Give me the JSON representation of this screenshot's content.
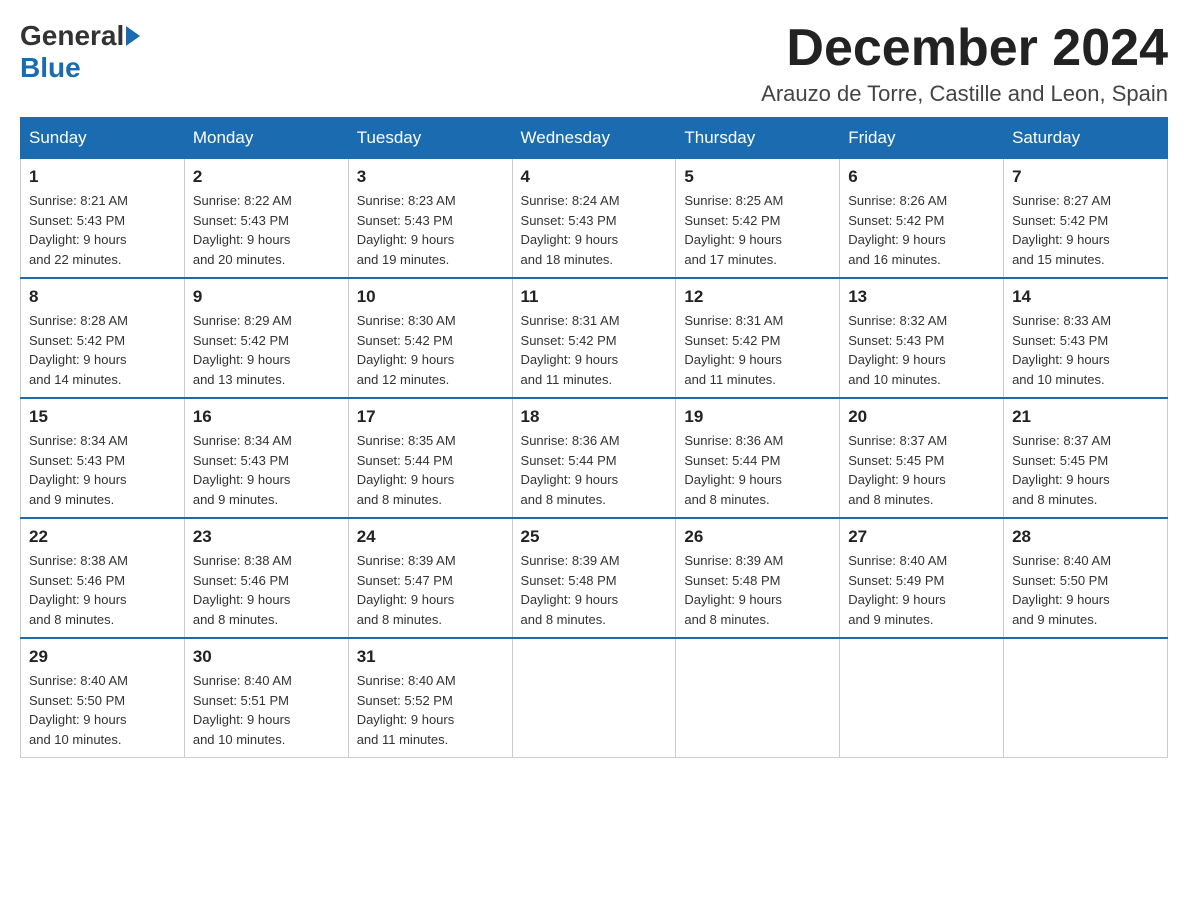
{
  "header": {
    "logo_general": "General",
    "logo_blue": "Blue",
    "month_title": "December 2024",
    "location": "Arauzo de Torre, Castille and Leon, Spain"
  },
  "weekdays": [
    "Sunday",
    "Monday",
    "Tuesday",
    "Wednesday",
    "Thursday",
    "Friday",
    "Saturday"
  ],
  "weeks": [
    [
      {
        "day": "1",
        "sunrise": "8:21 AM",
        "sunset": "5:43 PM",
        "daylight": "9 hours and 22 minutes."
      },
      {
        "day": "2",
        "sunrise": "8:22 AM",
        "sunset": "5:43 PM",
        "daylight": "9 hours and 20 minutes."
      },
      {
        "day": "3",
        "sunrise": "8:23 AM",
        "sunset": "5:43 PM",
        "daylight": "9 hours and 19 minutes."
      },
      {
        "day": "4",
        "sunrise": "8:24 AM",
        "sunset": "5:43 PM",
        "daylight": "9 hours and 18 minutes."
      },
      {
        "day": "5",
        "sunrise": "8:25 AM",
        "sunset": "5:42 PM",
        "daylight": "9 hours and 17 minutes."
      },
      {
        "day": "6",
        "sunrise": "8:26 AM",
        "sunset": "5:42 PM",
        "daylight": "9 hours and 16 minutes."
      },
      {
        "day": "7",
        "sunrise": "8:27 AM",
        "sunset": "5:42 PM",
        "daylight": "9 hours and 15 minutes."
      }
    ],
    [
      {
        "day": "8",
        "sunrise": "8:28 AM",
        "sunset": "5:42 PM",
        "daylight": "9 hours and 14 minutes."
      },
      {
        "day": "9",
        "sunrise": "8:29 AM",
        "sunset": "5:42 PM",
        "daylight": "9 hours and 13 minutes."
      },
      {
        "day": "10",
        "sunrise": "8:30 AM",
        "sunset": "5:42 PM",
        "daylight": "9 hours and 12 minutes."
      },
      {
        "day": "11",
        "sunrise": "8:31 AM",
        "sunset": "5:42 PM",
        "daylight": "9 hours and 11 minutes."
      },
      {
        "day": "12",
        "sunrise": "8:31 AM",
        "sunset": "5:42 PM",
        "daylight": "9 hours and 11 minutes."
      },
      {
        "day": "13",
        "sunrise": "8:32 AM",
        "sunset": "5:43 PM",
        "daylight": "9 hours and 10 minutes."
      },
      {
        "day": "14",
        "sunrise": "8:33 AM",
        "sunset": "5:43 PM",
        "daylight": "9 hours and 10 minutes."
      }
    ],
    [
      {
        "day": "15",
        "sunrise": "8:34 AM",
        "sunset": "5:43 PM",
        "daylight": "9 hours and 9 minutes."
      },
      {
        "day": "16",
        "sunrise": "8:34 AM",
        "sunset": "5:43 PM",
        "daylight": "9 hours and 9 minutes."
      },
      {
        "day": "17",
        "sunrise": "8:35 AM",
        "sunset": "5:44 PM",
        "daylight": "9 hours and 8 minutes."
      },
      {
        "day": "18",
        "sunrise": "8:36 AM",
        "sunset": "5:44 PM",
        "daylight": "9 hours and 8 minutes."
      },
      {
        "day": "19",
        "sunrise": "8:36 AM",
        "sunset": "5:44 PM",
        "daylight": "9 hours and 8 minutes."
      },
      {
        "day": "20",
        "sunrise": "8:37 AM",
        "sunset": "5:45 PM",
        "daylight": "9 hours and 8 minutes."
      },
      {
        "day": "21",
        "sunrise": "8:37 AM",
        "sunset": "5:45 PM",
        "daylight": "9 hours and 8 minutes."
      }
    ],
    [
      {
        "day": "22",
        "sunrise": "8:38 AM",
        "sunset": "5:46 PM",
        "daylight": "9 hours and 8 minutes."
      },
      {
        "day": "23",
        "sunrise": "8:38 AM",
        "sunset": "5:46 PM",
        "daylight": "9 hours and 8 minutes."
      },
      {
        "day": "24",
        "sunrise": "8:39 AM",
        "sunset": "5:47 PM",
        "daylight": "9 hours and 8 minutes."
      },
      {
        "day": "25",
        "sunrise": "8:39 AM",
        "sunset": "5:48 PM",
        "daylight": "9 hours and 8 minutes."
      },
      {
        "day": "26",
        "sunrise": "8:39 AM",
        "sunset": "5:48 PM",
        "daylight": "9 hours and 8 minutes."
      },
      {
        "day": "27",
        "sunrise": "8:40 AM",
        "sunset": "5:49 PM",
        "daylight": "9 hours and 9 minutes."
      },
      {
        "day": "28",
        "sunrise": "8:40 AM",
        "sunset": "5:50 PM",
        "daylight": "9 hours and 9 minutes."
      }
    ],
    [
      {
        "day": "29",
        "sunrise": "8:40 AM",
        "sunset": "5:50 PM",
        "daylight": "9 hours and 10 minutes."
      },
      {
        "day": "30",
        "sunrise": "8:40 AM",
        "sunset": "5:51 PM",
        "daylight": "9 hours and 10 minutes."
      },
      {
        "day": "31",
        "sunrise": "8:40 AM",
        "sunset": "5:52 PM",
        "daylight": "9 hours and 11 minutes."
      },
      null,
      null,
      null,
      null
    ]
  ]
}
